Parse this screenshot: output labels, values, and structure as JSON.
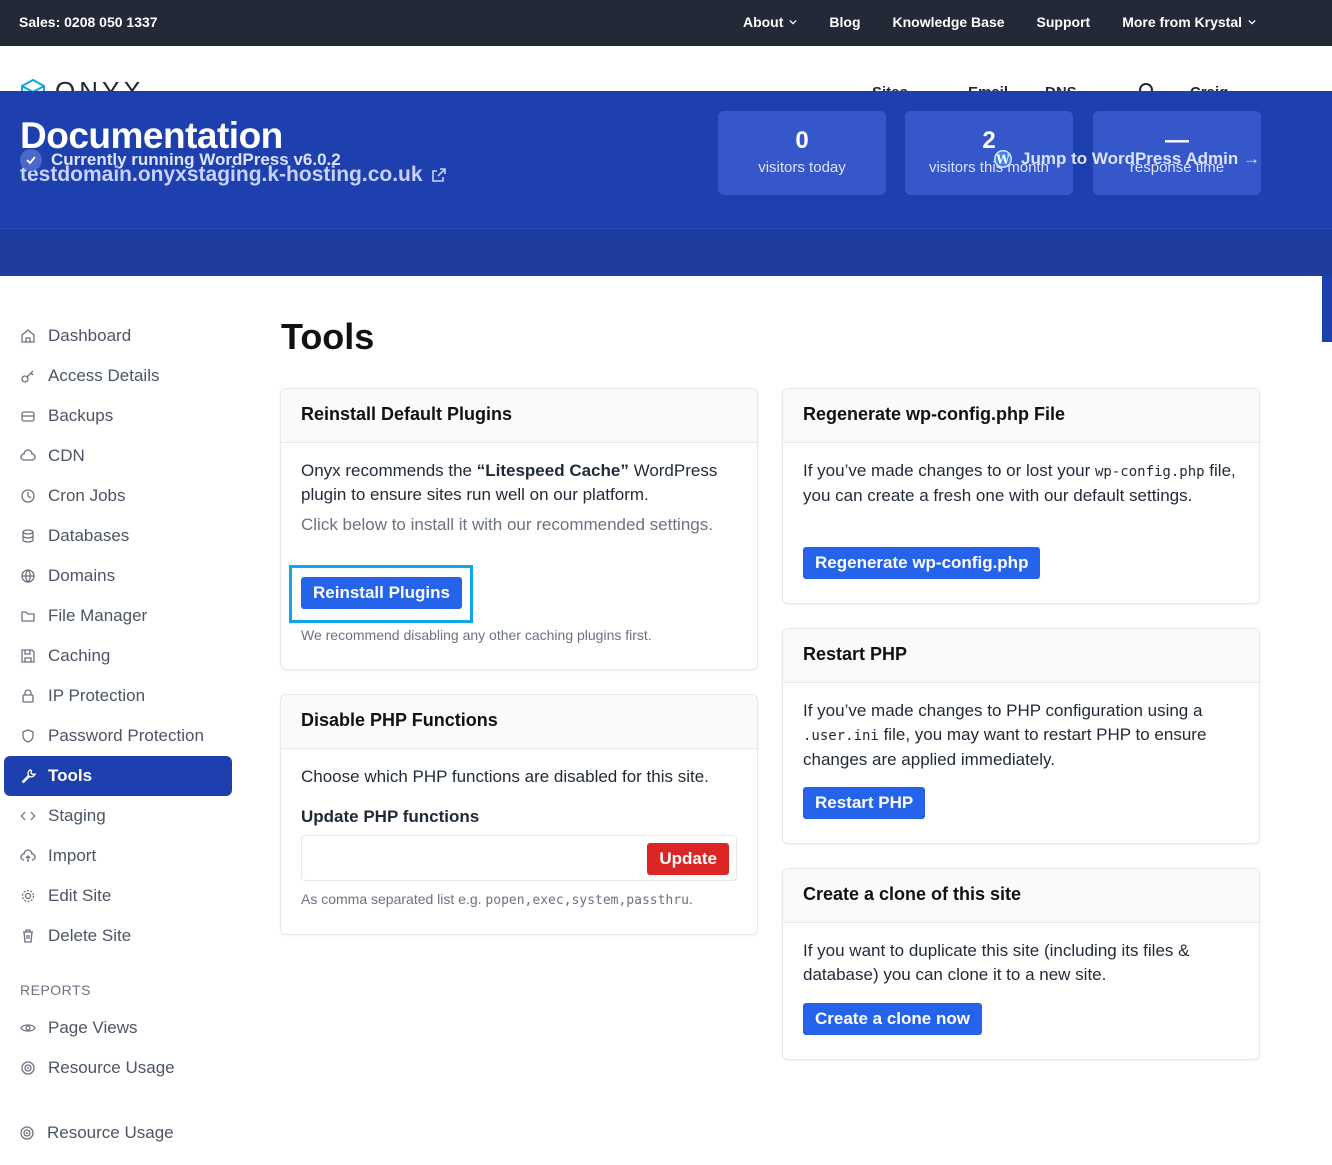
{
  "topbar": {
    "sales": "Sales: 0208 050 1337",
    "nav": [
      "About",
      "Blog",
      "Knowledge Base",
      "Support",
      "More from Krystal"
    ]
  },
  "subnav": {
    "logo": "ONYX",
    "items": [
      "Sites",
      "Email",
      "DNS",
      "Craig"
    ]
  },
  "hero": {
    "title": "Documentation",
    "domain": "testdomain.onyxstaging.k-hosting.co.uk",
    "stats": [
      {
        "value": "0",
        "label": "visitors today"
      },
      {
        "value": "2",
        "label": "visitors this month"
      },
      {
        "value": "—",
        "label": "response time"
      }
    ],
    "running": "Currently running WordPress v6.0.2",
    "wp_admin": "Jump to WordPress Admin →"
  },
  "sidebar": {
    "items": [
      {
        "label": "Dashboard",
        "icon": "home-icon"
      },
      {
        "label": "Access Details",
        "icon": "key-icon"
      },
      {
        "label": "Backups",
        "icon": "archive-icon"
      },
      {
        "label": "CDN",
        "icon": "cloud-icon"
      },
      {
        "label": "Cron Jobs",
        "icon": "clock-icon"
      },
      {
        "label": "Databases",
        "icon": "database-icon"
      },
      {
        "label": "Domains",
        "icon": "globe-icon"
      },
      {
        "label": "File Manager",
        "icon": "folder-icon"
      },
      {
        "label": "Caching",
        "icon": "save-icon"
      },
      {
        "label": "IP Protection",
        "icon": "lock-icon"
      },
      {
        "label": "Password Protection",
        "icon": "shield-icon"
      },
      {
        "label": "Tools",
        "icon": "wrench-icon"
      },
      {
        "label": "Staging",
        "icon": "code-icon"
      },
      {
        "label": "Import",
        "icon": "cloud-upload-icon"
      },
      {
        "label": "Edit Site",
        "icon": "gear-icon"
      },
      {
        "label": "Delete Site",
        "icon": "trash-icon"
      }
    ],
    "reports_header": "REPORTS",
    "reports": [
      {
        "label": "Page Views",
        "icon": "eye-icon"
      },
      {
        "label": "Resource Usage",
        "icon": "target-icon"
      }
    ],
    "extra": {
      "label": "Resource Usage",
      "icon": "target-icon"
    }
  },
  "main": {
    "title": "Tools",
    "reinstall": {
      "title": "Reinstall Default Plugins",
      "text_pre": "Onyx recommends the ",
      "text_bold": "“Litespeed Cache”",
      "text_post": " WordPress plugin to ensure sites run well on our platform.",
      "text2": "Click below to install it with our recommended settings.",
      "button": "Reinstall Plugins",
      "note": "We recommend disabling any other caching plugins first."
    },
    "php_functions": {
      "title": "Disable PHP Functions",
      "text": "Choose which PHP functions are disabled for this site.",
      "label": "Update PHP functions",
      "input_value": "",
      "button": "Update",
      "hint_pre": "As comma separated list e.g. ",
      "hint_code": "popen,exec,system,passthru",
      "hint_post": "."
    },
    "wpconfig": {
      "title": "Regenerate wp-config.php File",
      "text_pre": "If you’ve made changes to or lost your ",
      "text_code": "wp-config.php",
      "text_post": " file, you can create a fresh one with our default settings.",
      "button": "Regenerate wp-config.php"
    },
    "restart_php": {
      "title": "Restart PHP",
      "text_pre": "If you’ve made changes to PHP configuration using a ",
      "text_code": ".user.ini",
      "text_post": " file, you may want to restart PHP to ensure changes are applied immediately.",
      "button": "Restart PHP"
    },
    "clone": {
      "title": "Create a clone of this site",
      "text": "If you want to duplicate this site (including its files & database) you can clone it to a new site.",
      "button": "Create a clone now"
    }
  },
  "colors": {
    "brand": "#1e40af",
    "button": "#2563eb",
    "danger": "#dc2626",
    "highlight": "#0ea5e9"
  }
}
